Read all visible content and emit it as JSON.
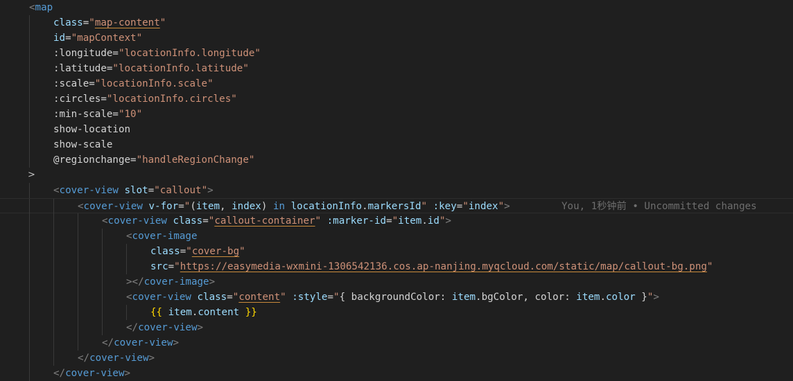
{
  "blame": "You, 1秒钟前 • Uncommitted changes",
  "fold_marker": ">",
  "lines": [
    {
      "tokens": [
        "<",
        "map"
      ]
    },
    {
      "tokens": [
        "class",
        "=",
        "\"",
        "map-content",
        "\""
      ]
    },
    {
      "tokens": [
        "id",
        "=",
        "\"mapContext\""
      ]
    },
    {
      "tokens": [
        ":longitude",
        "=",
        "\"locationInfo.longitude\""
      ]
    },
    {
      "tokens": [
        ":latitude",
        "=",
        "\"locationInfo.latitude\""
      ]
    },
    {
      "tokens": [
        ":scale",
        "=",
        "\"locationInfo.scale\""
      ]
    },
    {
      "tokens": [
        ":circles",
        "=",
        "\"locationInfo.circles\""
      ]
    },
    {
      "tokens": [
        ":min-scale",
        "=",
        "\"10\""
      ]
    },
    {
      "tokens": [
        "show-location"
      ]
    },
    {
      "tokens": [
        "show-scale"
      ]
    },
    {
      "tokens": [
        "@regionchange",
        "=",
        "\"handleRegionChange\""
      ]
    },
    {
      "tokens": []
    },
    {
      "tokens": [
        "<",
        "cover-view",
        " ",
        "slot",
        "=",
        "\"callout\"",
        ">"
      ]
    },
    {
      "tokens": [
        "<",
        "cover-view",
        " ",
        "v-for",
        "=",
        "\"",
        "(",
        "item",
        ", ",
        "index",
        ")",
        " in ",
        "locationInfo",
        ".",
        "markersId",
        "\"",
        " ",
        ":key",
        "=",
        "\"",
        "index",
        "\"",
        ">"
      ]
    },
    {
      "tokens": [
        "<",
        "cover-view",
        " ",
        "class",
        "=",
        "\"",
        "callout-container",
        "\"",
        " ",
        ":marker-id",
        "=",
        "\"",
        "item",
        ".",
        "id",
        "\"",
        ">"
      ]
    },
    {
      "tokens": [
        "<",
        "cover-image"
      ]
    },
    {
      "tokens": [
        "class",
        "=",
        "\"",
        "cover-bg",
        "\""
      ]
    },
    {
      "tokens": [
        "src",
        "=",
        "\"",
        "https://easymedia-wxmini-1306542136.cos.ap-nanjing.myqcloud.com/static/map/callout-bg.png",
        "\""
      ]
    },
    {
      "tokens": [
        "></",
        "cover-image",
        ">"
      ]
    },
    {
      "tokens": [
        "<",
        "cover-view",
        " ",
        "class",
        "=",
        "\"",
        "content",
        "\"",
        " ",
        ":style",
        "=",
        "\"",
        "{ ",
        "backgroundColor",
        ": ",
        "item",
        ".",
        "bgColor",
        ", ",
        "color",
        ": ",
        "item",
        ".",
        "color",
        " }",
        "\"",
        ">"
      ]
    },
    {
      "tokens": [
        "{{",
        " ",
        "item",
        ".",
        "content",
        " ",
        "}}"
      ]
    },
    {
      "tokens": [
        "</",
        "cover-view",
        ">"
      ]
    },
    {
      "tokens": [
        "</",
        "cover-view",
        ">"
      ]
    },
    {
      "tokens": [
        "</",
        "cover-view",
        ">"
      ]
    },
    {
      "tokens": [
        "</",
        "cover-view",
        ">"
      ]
    }
  ]
}
